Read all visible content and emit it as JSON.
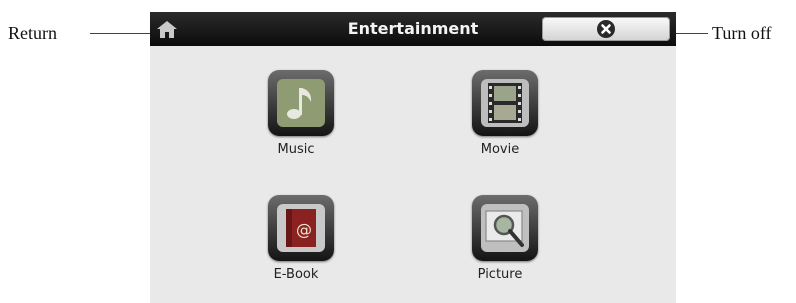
{
  "annotations": {
    "return_label": "Return",
    "turn_off_label": "Turn off"
  },
  "header": {
    "title": "Entertainment",
    "home_icon": "home-icon",
    "close_icon": "close-circle-icon"
  },
  "apps": [
    {
      "label": "Music",
      "icon": "music-note-icon"
    },
    {
      "label": "Movie",
      "icon": "film-strip-icon"
    },
    {
      "label": "E-Book",
      "icon": "book-icon"
    },
    {
      "label": "Picture",
      "icon": "picture-magnifier-icon"
    }
  ],
  "colors": {
    "topbar": "#111111",
    "screen_bg": "#e9e9e9",
    "title_text": "#f4f4f4"
  }
}
